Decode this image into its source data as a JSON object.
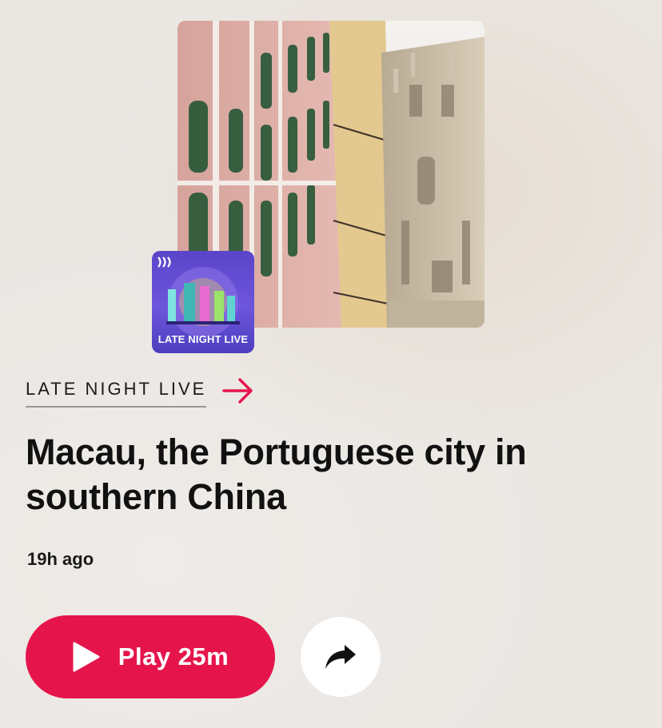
{
  "episode": {
    "program_name": "LATE NIGHT LIVE",
    "thumbnail_label": "LATE NIGHT LIVE",
    "title": "Macau, the Portuguese city in southern China",
    "published": "19h ago"
  },
  "actions": {
    "play_label": "Play 25m"
  },
  "colors": {
    "accent": "#e5154b",
    "thumbnail_bg": "#5a45c9",
    "text": "#111111"
  },
  "icons": {
    "program_link": "arrow-right-icon",
    "play": "play-icon",
    "share": "share-icon",
    "abc_logo": "abc-logo-icon"
  }
}
